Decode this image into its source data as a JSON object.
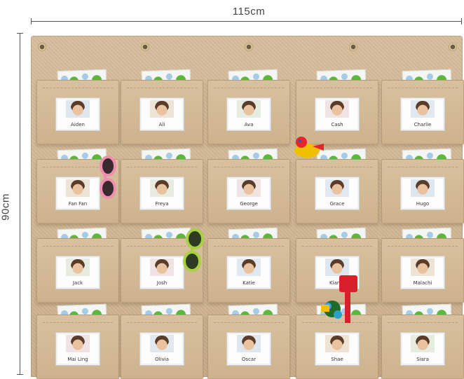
{
  "dimensions": {
    "width_label": "115cm",
    "height_label": "90cm"
  },
  "pockets": [
    [
      "Aiden",
      "Ali",
      "Ava",
      "Cash",
      "Charlie"
    ],
    [
      "Fan Fan",
      "Freya",
      "George",
      "Grace",
      "Hugo"
    ],
    [
      "Jack",
      "Josh",
      "Katie",
      "Kiama",
      "Malachi"
    ],
    [
      "Mai Ling",
      "Olivia",
      "Oscar",
      "Shae",
      "Siara"
    ]
  ],
  "props": [
    "sunglasses-pink",
    "sunglasses-green",
    "toy-duck",
    "toy-bucket-spade"
  ],
  "colors": {
    "felt": "#cdb28d",
    "dot_green": "#5cb83c",
    "dot_blue": "#a6cbe6",
    "pink_frame": "#ee8fae",
    "green_frame": "#a8d040",
    "toy_red": "#d9202a"
  }
}
